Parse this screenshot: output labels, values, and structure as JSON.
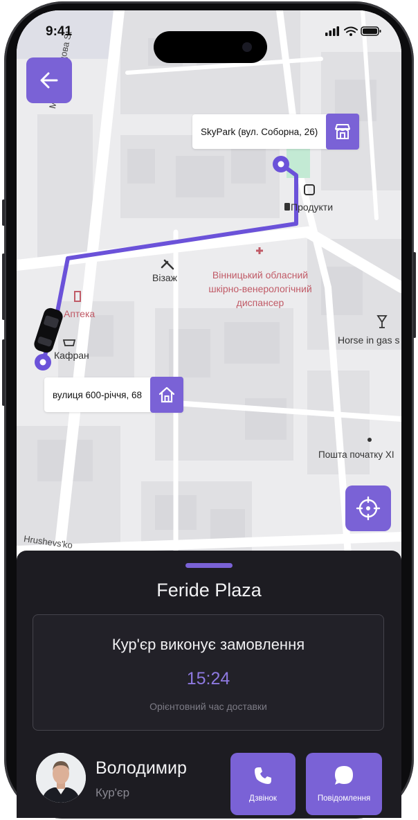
{
  "status_bar": {
    "time": "9:41"
  },
  "map": {
    "streets": {
      "ovodova": "Михайі Оводова St",
      "hrushevskoho": "Hrushevs'ko"
    },
    "origin_label": "SkyPark (вул. Соборна, 26)",
    "origin_icon": "store-icon",
    "destination_label": "вулиця 600-річчя, 68",
    "destination_icon": "home-icon",
    "pois": {
      "produkty": "Продукти",
      "vizazh": "Візаж",
      "apteka": "Аптека",
      "kafran": "Кафран",
      "dispanser": [
        "Вінницький обласний",
        "шкірно-венерологічний",
        "диспансер"
      ],
      "horse": "Horse in gas s",
      "poshta": "Пошта початку XI"
    },
    "accent_color": "#7a62d6"
  },
  "sheet": {
    "store_name": "Feride Plaza",
    "status": "Кур'єр виконує замовлення",
    "eta": "15:24",
    "eta_label": "Орієнтовний час доставки",
    "courier": {
      "name": "Володимир",
      "role": "Кур'єр"
    },
    "call_label": "Дзвінок",
    "message_label": "Повідомлення"
  }
}
